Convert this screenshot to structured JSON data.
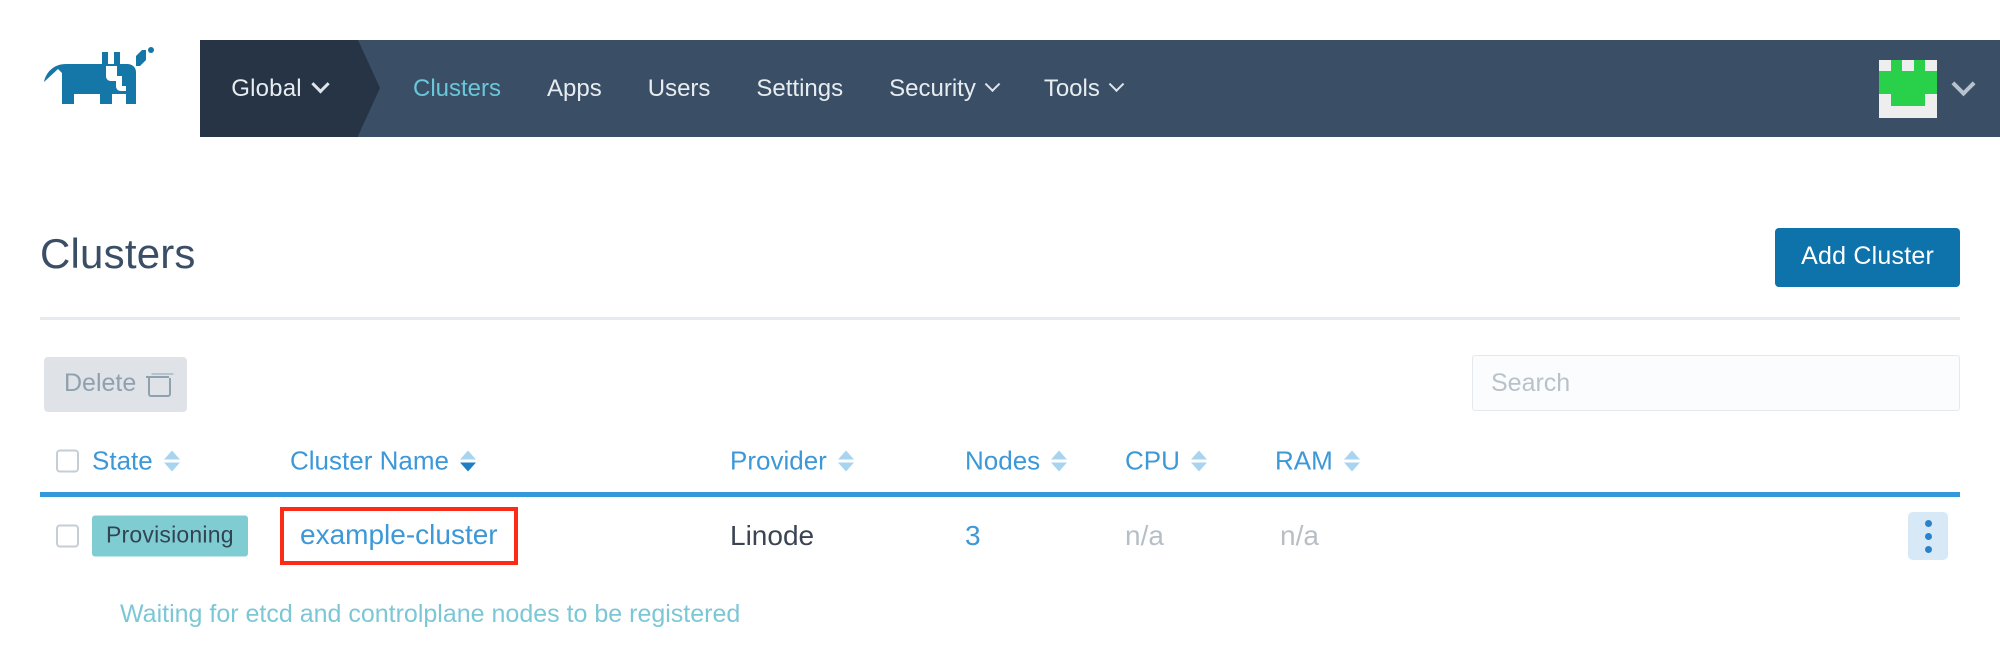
{
  "nav": {
    "logo_icon": "rancher-cow-logo",
    "context_label": "Global",
    "context_chevron_icon": "chevron-down-icon",
    "links": [
      {
        "label": "Clusters",
        "active": true,
        "has_chevron": false,
        "icon": ""
      },
      {
        "label": "Apps",
        "active": false,
        "has_chevron": false,
        "icon": ""
      },
      {
        "label": "Users",
        "active": false,
        "has_chevron": false,
        "icon": ""
      },
      {
        "label": "Settings",
        "active": false,
        "has_chevron": false,
        "icon": ""
      },
      {
        "label": "Security",
        "active": false,
        "has_chevron": true,
        "icon": "chevron-down-icon"
      },
      {
        "label": "Tools",
        "active": false,
        "has_chevron": true,
        "icon": "chevron-down-icon"
      }
    ],
    "user_menu": {
      "avatar_icon": "user-identicon-avatar",
      "chevron_icon": "chevron-down-icon"
    }
  },
  "page": {
    "title": "Clusters",
    "add_button_label": "Add Cluster"
  },
  "toolbar": {
    "delete_label": "Delete",
    "delete_icon": "trash-icon",
    "delete_disabled": true,
    "search_placeholder": "Search",
    "search_value": ""
  },
  "table": {
    "select_all_checkbox": "unchecked",
    "columns": [
      {
        "label": "State",
        "sort_icon": "sort-arrows-icon",
        "sorted": false
      },
      {
        "label": "Cluster Name",
        "sort_icon": "sort-arrows-icon",
        "sorted": true
      },
      {
        "label": "Provider",
        "sort_icon": "sort-arrows-icon",
        "sorted": false
      },
      {
        "label": "Nodes",
        "sort_icon": "sort-arrows-icon",
        "sorted": false
      },
      {
        "label": "CPU",
        "sort_icon": "sort-arrows-icon",
        "sorted": false
      },
      {
        "label": "RAM",
        "sort_icon": "sort-arrows-icon",
        "sorted": false
      }
    ],
    "rows": [
      {
        "checkbox": "unchecked",
        "state": "Provisioning",
        "name": "example-cluster",
        "name_highlighted": true,
        "provider": "Linode",
        "nodes": "3",
        "cpu": "n/a",
        "ram": "n/a",
        "actions_icon": "kebab-menu-icon",
        "status_message": "Waiting for etcd and controlplane nodes to be registered"
      }
    ]
  },
  "colors": {
    "nav_bg": "#3a4f66",
    "nav_context_bg": "#263445",
    "nav_active_text": "#6bc6d9",
    "brand_blue": "#0f73ab",
    "link_blue": "#3d98d8",
    "header_rule": "#3498db",
    "badge_bg": "#7fcdd3",
    "status_text": "#7cc7d6",
    "highlight_box": "#fb2b18",
    "avatar_green": "#29d049"
  }
}
